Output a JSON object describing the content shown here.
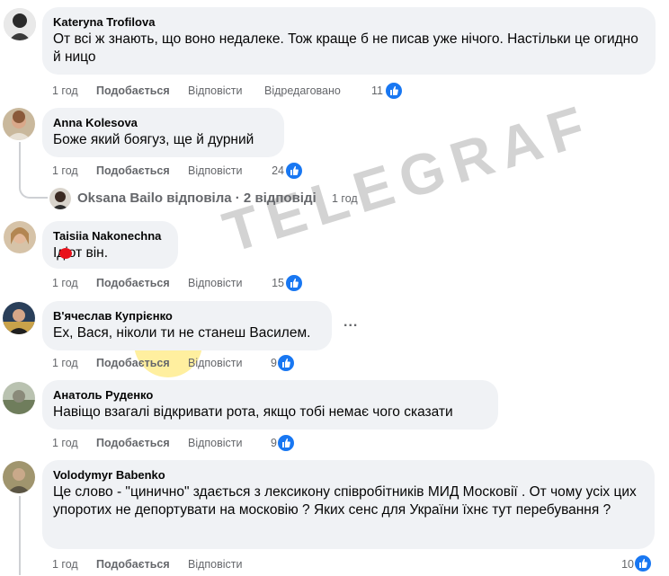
{
  "comments": [
    {
      "author": "Kateryna Trofilova",
      "text": "От всі ж знають, що воно недалеке. Тож краще б не писав уже нічого. Настільки це огидно й ницо",
      "time": "1 год",
      "like": "Подобається",
      "reply": "Відповісти",
      "edited": "Відредаговано",
      "reactions": "11"
    },
    {
      "author": "Anna Kolesova",
      "text": "Боже який боягуз, ще й дурний",
      "time": "1 год",
      "like": "Подобається",
      "reply": "Відповісти",
      "reactions": "24"
    },
    {
      "author": "Taisiia Nakonechna",
      "text": "Ідіот він.",
      "time": "1 год",
      "like": "Подобається",
      "reply": "Відповісти",
      "reactions": "15"
    },
    {
      "author": "В'ячеслав Купрієнко",
      "text": "Ех, Вася, ніколи ти не станеш Василем.",
      "time": "1 год",
      "like": "Подобається",
      "reply": "Відповісти",
      "reactions": "9"
    },
    {
      "author": "Анатоль Руденко",
      "text": "Навіщо взагалі відкривати рота, якщо тобі немає чого сказати",
      "time": "1 год",
      "like": "Подобається",
      "reply": "Відповісти",
      "reactions": "9"
    },
    {
      "author": "Volodymyr Babenko",
      "text": "Це слово - \"цинично\" здається з лексикону співробітників МИД Московії . От чому усіх цих упоротих не депортувати на московію ? Яких сенс для України їхнє тут перебування ?",
      "time": "1 год",
      "like": "Подобається",
      "reply": "Відповісти",
      "reactions": "10"
    }
  ],
  "reply_summary": {
    "text": "Oksana Bailo відповіла · 2 відповіді",
    "time": "1 год"
  },
  "more_menu": "...",
  "watermark": "TELEGRAF",
  "colors": {
    "bubble": "#f0f2f5",
    "meta": "#65676b",
    "reaction": "#1877f2",
    "thread": "#ced0d4"
  }
}
